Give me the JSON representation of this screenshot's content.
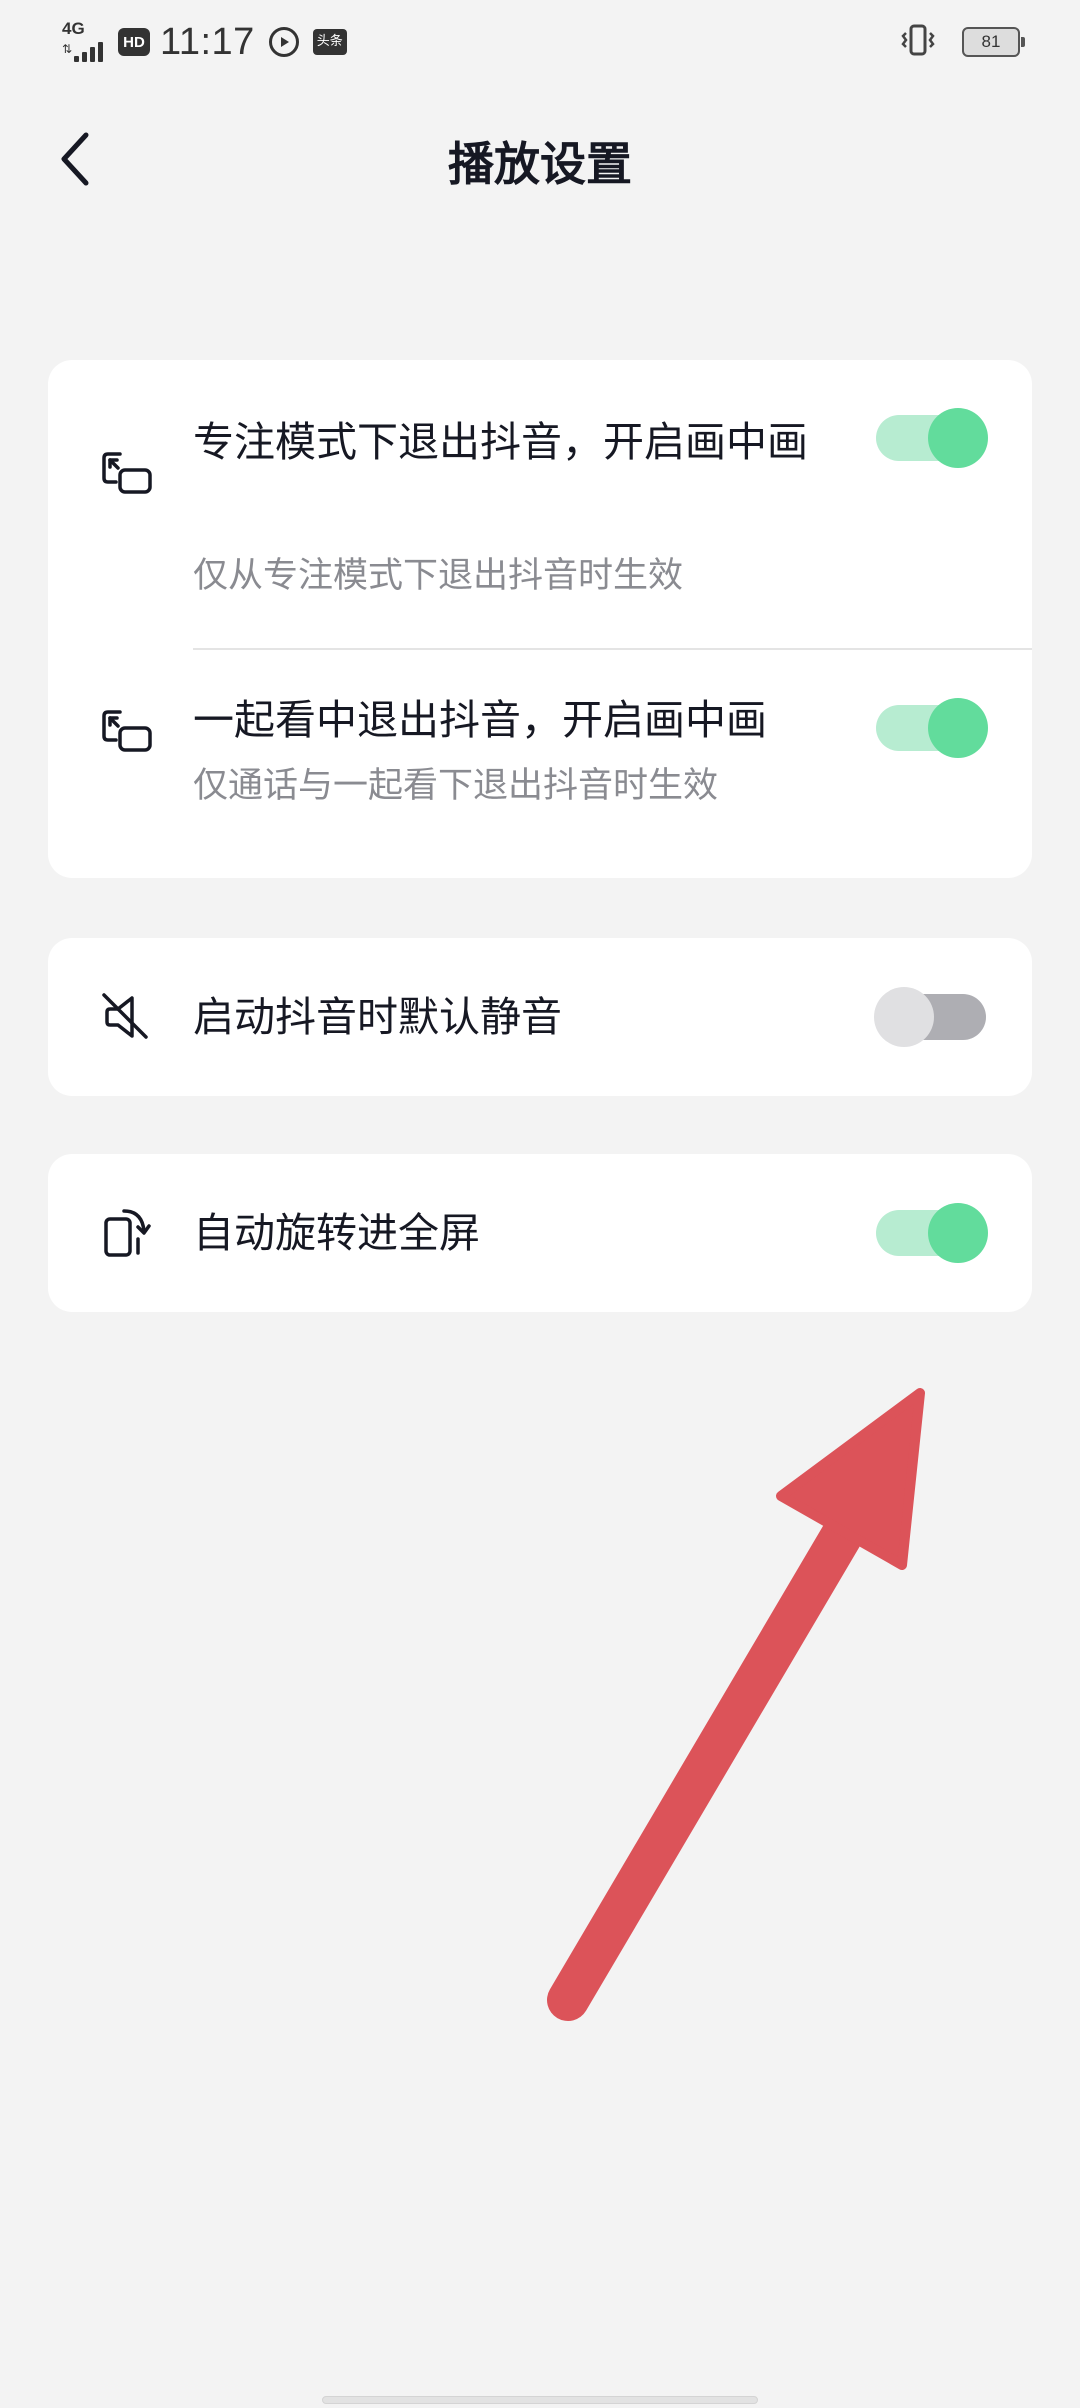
{
  "status_bar": {
    "network": "4G",
    "hd": "HD",
    "time": "11:17",
    "news_app": "头条",
    "battery": "81"
  },
  "header": {
    "title": "播放设置"
  },
  "settings": {
    "pip_focus": {
      "title": "专注模式下退出抖音，开启画中画",
      "subtitle": "仅从专注模式下退出抖音时生效",
      "enabled": true
    },
    "pip_watch_together": {
      "title": "一起看中退出抖音，开启画中画",
      "subtitle": "仅通话与一起看下退出抖音时生效",
      "enabled": true
    },
    "mute_on_launch": {
      "title": "启动抖音时默认静音",
      "enabled": false
    },
    "auto_rotate": {
      "title": "自动旋转进全屏",
      "enabled": true
    }
  },
  "annotation": {
    "arrow_color": "#dc5359"
  },
  "colors": {
    "toggle_on_knob": "#62dc9c",
    "toggle_on_track": "#b7ecd1",
    "toggle_off_knob": "#e0e0e2",
    "toggle_off_track": "#aeaeb3",
    "background": "#f3f3f3"
  },
  "icons": {
    "back": "chevron-left-icon",
    "pip": "picture-in-picture-icon",
    "mute": "speaker-muted-icon",
    "rotate": "rotate-screen-icon"
  }
}
